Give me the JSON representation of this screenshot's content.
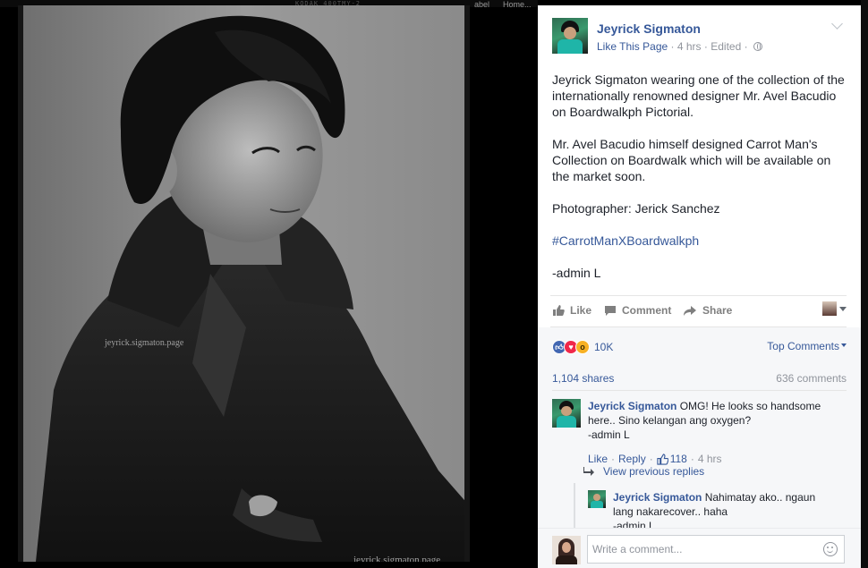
{
  "top_strip": {
    "film_code": "KODAK 400TMY-2",
    "tab_fragment_1": "abel",
    "tab_fragment_2": "Home..."
  },
  "photo": {
    "watermark_1": "jeyrick.sigmaton.page",
    "watermark_2": "jeyrick.sigmaton.page"
  },
  "post": {
    "page_name": "Jeyrick Sigmaton",
    "like_page": "Like This Page",
    "time": "4 hrs",
    "edited": "Edited",
    "paragraphs": [
      "Jeyrick Sigmaton wearing one of the collection of the internationally renowned designer Mr. Avel Bacudio on Boardwalkph Pictorial.",
      "Mr. Avel Bacudio himself designed Carrot Man's Collection on Boardwalk which will be available on the market soon.",
      "Photographer: Jerick Sanchez"
    ],
    "hashtag": "#CarrotManXBoardwalkph",
    "signature": "-admin L"
  },
  "actions": {
    "like": "Like",
    "comment": "Comment",
    "share": "Share"
  },
  "stats": {
    "reaction_count": "10K",
    "top_comments": "Top Comments",
    "shares": "1,104 shares",
    "comments": "636 comments"
  },
  "comment": {
    "author": "Jeyrick Sigmaton",
    "text": "OMG! He looks so handsome here.. Sino kelangan ang oxygen?",
    "signature": "-admin L",
    "like": "Like",
    "reply": "Reply",
    "likes": "118",
    "time": "4 hrs"
  },
  "replies": {
    "view_previous": "View previous replies",
    "reply": {
      "author": "Jeyrick Sigmaton",
      "text": "Nahimatay ako.. ngaun lang nakarecover.. haha",
      "signature": "-admin L"
    }
  },
  "composer": {
    "placeholder": "Write a comment..."
  },
  "colors": {
    "link_blue": "#365899",
    "muted": "#90949c",
    "like_blue": "#4267b2",
    "love_red": "#f0284a",
    "wow_yellow": "#f7b125"
  }
}
